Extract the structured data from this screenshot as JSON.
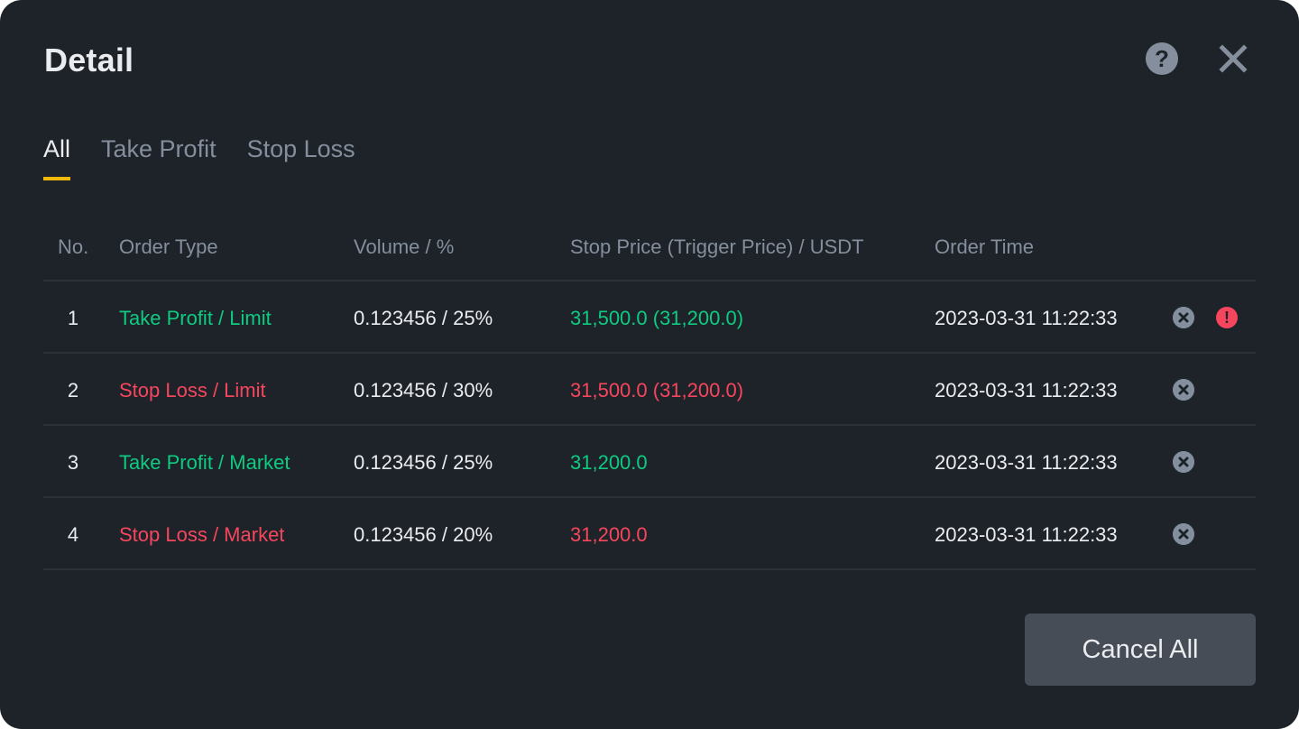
{
  "header": {
    "title": "Detail",
    "help_icon_glyph": "?",
    "help_icon": "help-icon",
    "close_icon": "close-icon"
  },
  "tabs": [
    {
      "label": "All",
      "active": true
    },
    {
      "label": "Take Profit",
      "active": false
    },
    {
      "label": "Stop Loss",
      "active": false
    }
  ],
  "table": {
    "columns": [
      "No.",
      "Order Type",
      "Volume / %",
      "Stop Price (Trigger Price) / USDT",
      "Order Time"
    ],
    "rows": [
      {
        "no": "1",
        "type": "Take Profit / Limit",
        "side": "green",
        "volume": "0.123456 / 25%",
        "price": "31,500.0 (31,200.0)",
        "time": "2023-03-31 11:22:33",
        "warning": true
      },
      {
        "no": "2",
        "type": "Stop Loss / Limit",
        "side": "red",
        "volume": "0.123456 / 30%",
        "price": "31,500.0 (31,200.0)",
        "time": "2023-03-31 11:22:33",
        "warning": false
      },
      {
        "no": "3",
        "type": "Take Profit / Market",
        "side": "green",
        "volume": "0.123456 / 25%",
        "price": "31,200.0",
        "time": "2023-03-31 11:22:33",
        "warning": false
      },
      {
        "no": "4",
        "type": "Stop Loss / Market",
        "side": "red",
        "volume": "0.123456 / 20%",
        "price": "31,200.0",
        "time": "2023-03-31 11:22:33",
        "warning": false
      }
    ]
  },
  "warning_glyph": "!",
  "footer": {
    "cancel_all_label": "Cancel All"
  },
  "colors": {
    "background": "#1e2329",
    "accent": "#f0b90b",
    "profit": "#0ecb81",
    "loss": "#f6465d",
    "muted": "#848e9c",
    "text": "#eaecef",
    "button": "#474d57"
  }
}
